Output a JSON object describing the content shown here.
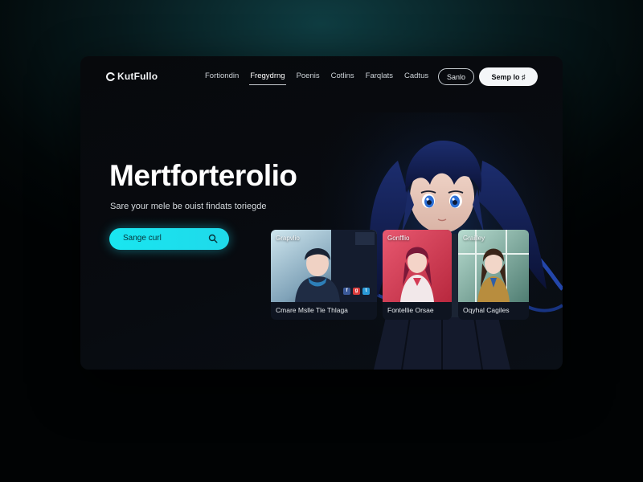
{
  "nav": {
    "logo_text": "KutFullo",
    "menu": [
      "Fortiondin",
      "Fregydrng",
      "Poenis",
      "Cotlins",
      "Farqlats",
      "Cadtus"
    ],
    "active_index": 1,
    "signin_label": "Sanlo",
    "signup_label": "Semp lo ♯"
  },
  "hero": {
    "title": "Mertforterolio",
    "subtitle": "Sare your mele be ouist findats toriegde"
  },
  "search": {
    "placeholder": "Sange curl"
  },
  "cards": [
    {
      "tag": "Grapvlio",
      "caption": "Cmare Mslle Tle Thlaga"
    },
    {
      "tag": "Gonfflio",
      "caption": "Fontellie Orsae"
    },
    {
      "tag": "Grailley",
      "caption": "Oqyhal Cagiles"
    }
  ],
  "colors": {
    "accent": "#1fe0ee",
    "background": "#07090c",
    "text": "#ffffff"
  }
}
